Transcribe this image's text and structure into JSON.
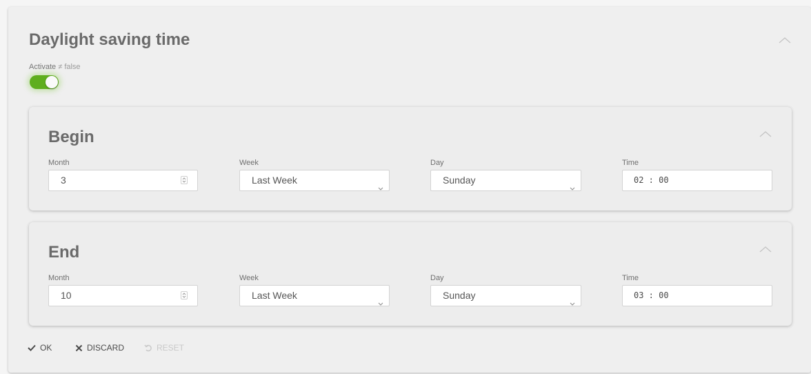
{
  "section": {
    "title": "Daylight saving time",
    "activate_label": "Activate",
    "activate_neq": "≠",
    "activate_value": "false",
    "activate_on": true
  },
  "begin": {
    "title": "Begin",
    "month_label": "Month",
    "month_value": "3",
    "week_label": "Week",
    "week_value": "Last Week",
    "day_label": "Day",
    "day_value": "Sunday",
    "time_label": "Time",
    "time_value": "02 : 00"
  },
  "end": {
    "title": "End",
    "month_label": "Month",
    "month_value": "10",
    "week_label": "Week",
    "week_value": "Last Week",
    "day_label": "Day",
    "day_value": "Sunday",
    "time_label": "Time",
    "time_value": "03 : 00"
  },
  "actions": {
    "ok_label": "OK",
    "discard_label": "DISCARD",
    "reset_label": "RESET"
  },
  "colors": {
    "toggle_on": "#5fae1e",
    "card_bg": "#efefef"
  },
  "icons": {
    "collapse": "chevron-up-icon",
    "ok": "check-icon",
    "discard": "close-icon",
    "reset": "undo-icon",
    "select": "chevron-down-icon",
    "spinner": "spinner-arrows-icon"
  }
}
